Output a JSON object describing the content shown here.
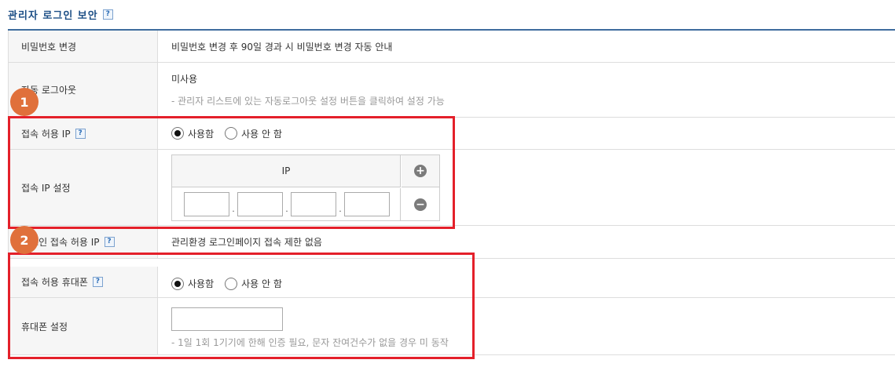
{
  "section": {
    "title": "관리자 로그인 보안",
    "help_glyph": "?"
  },
  "rows": {
    "password_change": {
      "label": "비밀번호 변경",
      "value": "비밀번호 변경 후 90일 경과 시 비밀번호 변경 자동 안내"
    },
    "auto_logout": {
      "label": "자동 로그아웃",
      "value": "미사용",
      "hint": "- 관리자 리스트에 있는 자동로그아웃 설정 버튼을 클릭하여 설정 가능"
    },
    "allowed_ip": {
      "label": "접속 허용 IP",
      "option_use": "사용함",
      "option_not_use": "사용 안 함",
      "selected": "사용함"
    },
    "ip_settings": {
      "label": "접속 IP 설정",
      "table_header": "IP",
      "add_glyph": "+",
      "remove_glyph": "−",
      "octets": [
        "",
        "",
        "",
        ""
      ],
      "dot": "."
    },
    "login_allowed_ip": {
      "label": "로그인 접속 허용 IP",
      "value": "관리환경 로그인페이지 접속 제한 없음"
    },
    "allowed_phone": {
      "label": "접속 허용 휴대폰",
      "option_use": "사용함",
      "option_not_use": "사용 안 함",
      "selected": "사용함"
    },
    "phone_settings": {
      "label": "휴대폰 설정",
      "value": "",
      "hint": "- 1일 1회 1기기에 한해 인증 필요, 문자 잔여건수가 없을 경우 미 동작"
    }
  },
  "annotations": {
    "badge_1": "1",
    "badge_2": "2",
    "highlight_color": "#e4202a",
    "badge_color": "#e0703b"
  }
}
